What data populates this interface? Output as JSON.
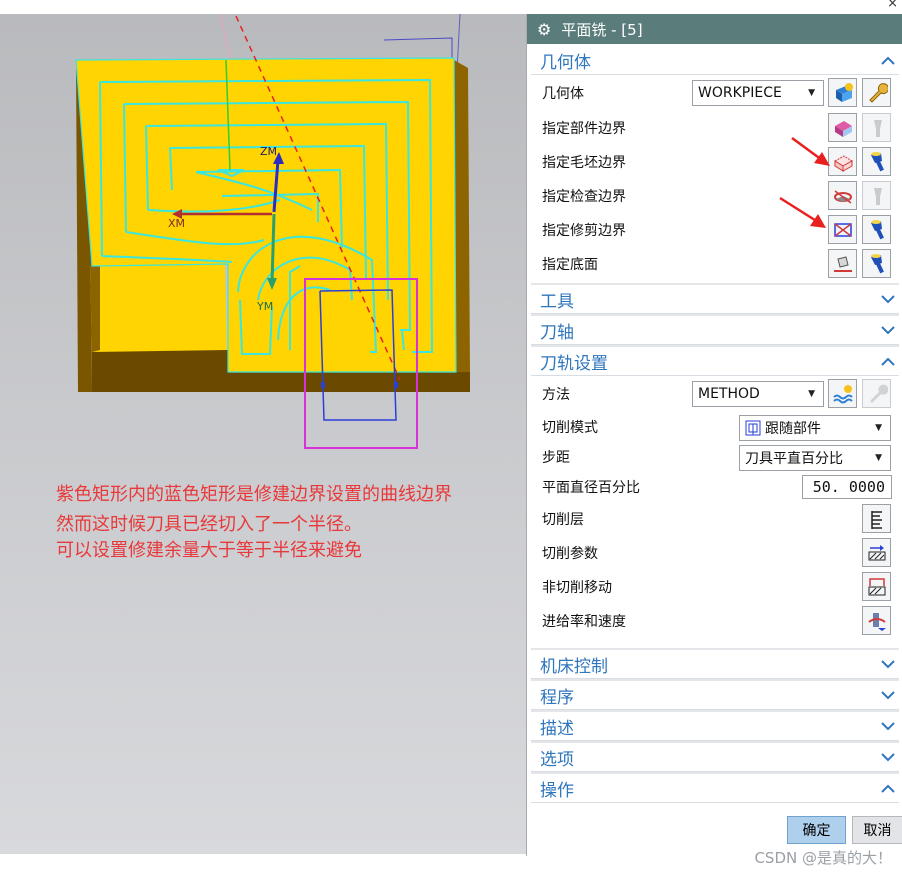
{
  "dialog": {
    "title": "平面铣 - [5]",
    "sections": {
      "geometry": "几何体",
      "tool": "工具",
      "tool_axis": "刀轴",
      "path_settings": "刀轨设置",
      "machine_control": "机床控制",
      "program": "程序",
      "description": "描述",
      "options": "选项",
      "actions": "操作"
    },
    "geometry": {
      "geometry_label": "几何体",
      "geometry_value": "WORKPIECE",
      "part_boundary": "指定部件边界",
      "blank_boundary": "指定毛坯边界",
      "check_boundary": "指定检查边界",
      "trim_boundary": "指定修剪边界",
      "floor": "指定底面"
    },
    "path": {
      "method_label": "方法",
      "method_value": "METHOD",
      "cut_pattern_label": "切削模式",
      "cut_pattern_value": "跟随部件",
      "stepover_label": "步距",
      "stepover_value": "刀具平直百分比",
      "percent_label": "平面直径百分比",
      "percent_value": "50. 0000",
      "cut_levels": "切削层",
      "cut_params": "切削参数",
      "non_cut_moves": "非切削移动",
      "feeds_speeds": "进给率和速度"
    },
    "buttons": {
      "ok": "确定",
      "cancel": "取消"
    }
  },
  "viewport": {
    "axis_labels": {
      "zm": "ZM",
      "xm": "XM",
      "ym": "YM"
    },
    "annotation": [
      "紫色矩形内的蓝色矩形是修建边界设置的曲线边界",
      "然而这时候刀具已经切入了一个半径。",
      "可以设置修建余量大于等于半径来避免"
    ]
  },
  "watermark": "CSDN @是真的大！",
  "colors": {
    "title_bar": "#5a7d7b",
    "section_text": "#2f76bd",
    "part_top": "#ffd400",
    "part_side": "#6b4a00",
    "toolpath": "#39e6e0",
    "annotation": "#e8383a",
    "trim_rect": "#d633d6",
    "ok_button": "#aed0ec"
  }
}
